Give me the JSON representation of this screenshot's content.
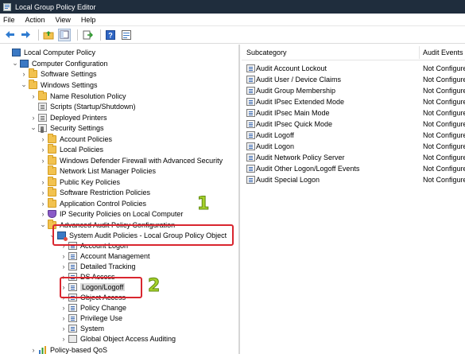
{
  "window": {
    "title": "Local Group Policy Editor"
  },
  "menu": [
    "File",
    "Action",
    "View",
    "Help"
  ],
  "toolbar": {
    "buttons": [
      "back-icon",
      "forward-icon",
      "up-folder-icon",
      "show-hide-tree-icon",
      "export-list-icon",
      "help-icon",
      "properties-icon"
    ]
  },
  "tree": {
    "items": [
      {
        "label": "Local Computer Policy",
        "icon": "computer",
        "chev": ""
      },
      {
        "label": "Computer Configuration",
        "icon": "computer",
        "chev": "v"
      },
      {
        "label": "Software Settings",
        "icon": "folder",
        "chev": ">"
      },
      {
        "label": "Windows Settings",
        "icon": "folder",
        "chev": "v"
      },
      {
        "label": "Name Resolution Policy",
        "icon": "folder",
        "chev": ">"
      },
      {
        "label": "Scripts (Startup/Shutdown)",
        "icon": "policy",
        "chev": ""
      },
      {
        "label": "Deployed Printers",
        "icon": "policy",
        "chev": ">"
      },
      {
        "label": "Security Settings",
        "icon": "lock",
        "chev": "v"
      },
      {
        "label": "Account Policies",
        "icon": "folder",
        "chev": ">"
      },
      {
        "label": "Local Policies",
        "icon": "folder",
        "chev": ">"
      },
      {
        "label": "Windows Defender Firewall with Advanced Security",
        "icon": "folder",
        "chev": ">"
      },
      {
        "label": "Network List Manager Policies",
        "icon": "folder",
        "chev": ""
      },
      {
        "label": "Public Key Policies",
        "icon": "folder",
        "chev": ">"
      },
      {
        "label": "Software Restriction Policies",
        "icon": "folder",
        "chev": ">"
      },
      {
        "label": "Application Control Policies",
        "icon": "folder",
        "chev": ">"
      },
      {
        "label": "IP Security Policies on Local Computer",
        "icon": "shield",
        "chev": ">"
      },
      {
        "label": "Advanced Audit Policy Configuration",
        "icon": "folder",
        "chev": "v"
      },
      {
        "label": "System Audit Policies - Local Group Policy Object",
        "icon": "sysaudit",
        "chev": "v"
      },
      {
        "label": "Account Logon",
        "icon": "audit",
        "chev": ">"
      },
      {
        "label": "Account Management",
        "icon": "audit",
        "chev": ">"
      },
      {
        "label": "Detailed Tracking",
        "icon": "audit",
        "chev": ">"
      },
      {
        "label": "DS Access",
        "icon": "audit",
        "chev": ">"
      },
      {
        "label": "Logon/Logoff",
        "icon": "audit",
        "chev": ">"
      },
      {
        "label": "Object Access",
        "icon": "audit",
        "chev": ">"
      },
      {
        "label": "Policy Change",
        "icon": "audit",
        "chev": ">"
      },
      {
        "label": "Privilege Use",
        "icon": "audit",
        "chev": ">"
      },
      {
        "label": "System",
        "icon": "audit",
        "chev": ">"
      },
      {
        "label": "Global Object Access Auditing",
        "icon": "global",
        "chev": ">"
      },
      {
        "label": "Policy-based QoS",
        "icon": "chart",
        "chev": ">"
      }
    ]
  },
  "callouts": {
    "one": "1",
    "two": "2"
  },
  "list": {
    "headers": {
      "subcategory": "Subcategory",
      "audit_events": "Audit Events"
    },
    "rows": [
      {
        "name": "Audit Account Lockout",
        "value": "Not Configured"
      },
      {
        "name": "Audit User / Device Claims",
        "value": "Not Configured"
      },
      {
        "name": "Audit Group Membership",
        "value": "Not Configured"
      },
      {
        "name": "Audit IPsec Extended Mode",
        "value": "Not Configured"
      },
      {
        "name": "Audit IPsec Main Mode",
        "value": "Not Configured"
      },
      {
        "name": "Audit IPsec Quick Mode",
        "value": "Not Configured"
      },
      {
        "name": "Audit Logoff",
        "value": "Not Configured"
      },
      {
        "name": "Audit Logon",
        "value": "Not Configured"
      },
      {
        "name": "Audit Network Policy Server",
        "value": "Not Configured"
      },
      {
        "name": "Audit Other Logon/Logoff Events",
        "value": "Not Configured"
      },
      {
        "name": "Audit Special Logon",
        "value": "Not Configured"
      }
    ]
  }
}
